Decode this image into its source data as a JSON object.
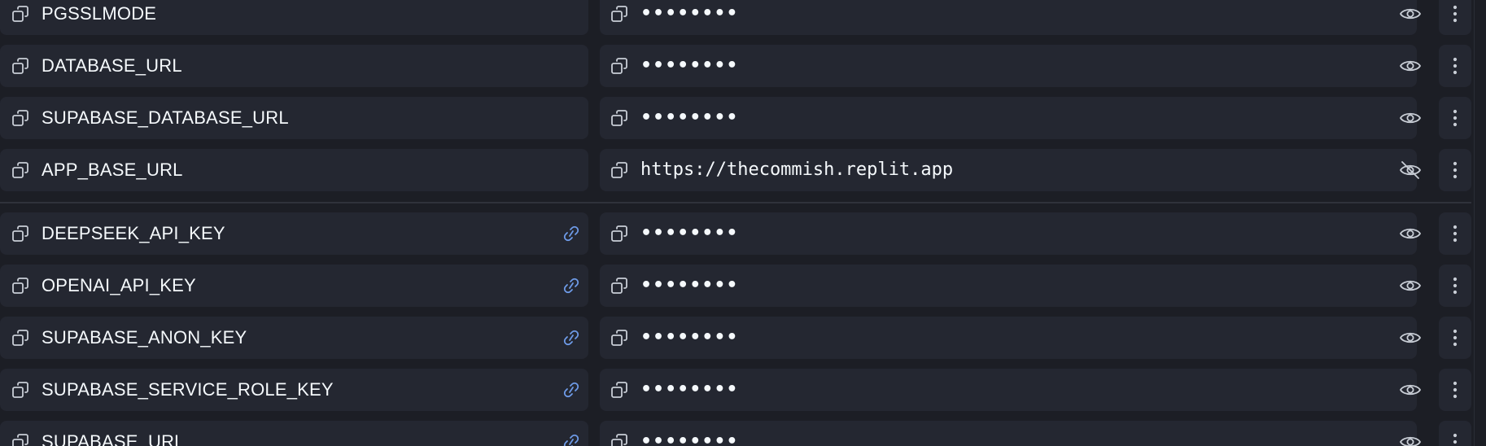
{
  "colors": {
    "background": "#1c1e25",
    "cell": "#242731",
    "text": "#f5f9fc",
    "icon": "#c9ced6",
    "link_accent": "#6e9be8"
  },
  "groups": [
    {
      "rows": [
        {
          "key": "PGSSLMODE",
          "value": "••••••••",
          "linked": false,
          "visibility_icon": "eye-icon"
        },
        {
          "key": "DATABASE_URL",
          "value": "••••••••",
          "linked": false,
          "visibility_icon": "eye-icon"
        },
        {
          "key": "SUPABASE_DATABASE_URL",
          "value": "••••••••",
          "linked": false,
          "visibility_icon": "eye-icon"
        },
        {
          "key": "APP_BASE_URL",
          "value": "https://thecommish.replit.app",
          "linked": false,
          "visibility_icon": "eye-off-icon"
        }
      ]
    },
    {
      "rows": [
        {
          "key": "DEEPSEEK_API_KEY",
          "value": "••••••••",
          "linked": true,
          "visibility_icon": "eye-icon"
        },
        {
          "key": "OPENAI_API_KEY",
          "value": "••••••••",
          "linked": true,
          "visibility_icon": "eye-icon"
        },
        {
          "key": "SUPABASE_ANON_KEY",
          "value": "••••••••",
          "linked": true,
          "visibility_icon": "eye-icon"
        },
        {
          "key": "SUPABASE_SERVICE_ROLE_KEY",
          "value": "••••••••",
          "linked": true,
          "visibility_icon": "eye-icon"
        },
        {
          "key": "SUPABASE_URL",
          "value": "••••••••",
          "linked": true,
          "visibility_icon": "eye-icon"
        }
      ]
    }
  ]
}
